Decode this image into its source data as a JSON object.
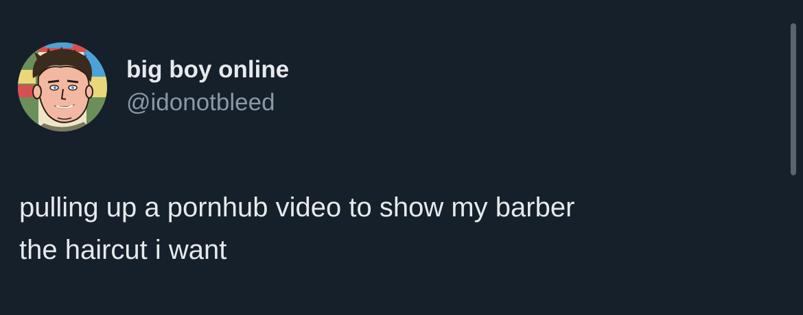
{
  "tweet": {
    "display_name": "big boy online",
    "handle": "@idonotbleed",
    "text": "pulling up a pornhub video to show my barber\nthe haircut i want"
  },
  "avatar": {
    "icon": "cartoon-face-avatar-icon",
    "background_colors": [
      "#2f6f4f",
      "#e9d77a",
      "#d94f4f",
      "#4aa3d8",
      "#efe6c8"
    ],
    "skin_color": "#f2b8a2",
    "hair_color": "#3b2a1e"
  },
  "theme": {
    "background": "#15202b",
    "primary_text": "#e7e9ea",
    "secondary_text": "#8b98a5",
    "scrollbar": "#5b6570"
  }
}
